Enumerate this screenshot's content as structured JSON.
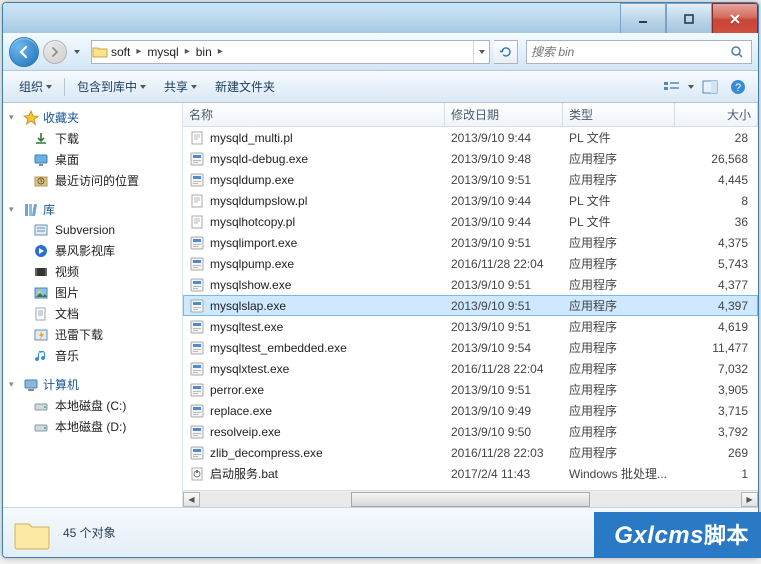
{
  "breadcrumbs": [
    "soft",
    "mysql",
    "bin"
  ],
  "search_placeholder": "搜索 bin",
  "toolbar": {
    "organize": "组织",
    "include": "包含到库中",
    "share": "共享",
    "newfolder": "新建文件夹"
  },
  "sidebar": {
    "favorites": {
      "label": "收藏夹",
      "items": [
        {
          "icon": "download",
          "label": "下载"
        },
        {
          "icon": "desktop",
          "label": "桌面"
        },
        {
          "icon": "recent",
          "label": "最近访问的位置"
        }
      ]
    },
    "libraries": {
      "label": "库",
      "items": [
        {
          "icon": "svn",
          "label": "Subversion"
        },
        {
          "icon": "storm",
          "label": "暴风影视库"
        },
        {
          "icon": "video",
          "label": "视频"
        },
        {
          "icon": "pictures",
          "label": "图片"
        },
        {
          "icon": "documents",
          "label": "文档"
        },
        {
          "icon": "thunder",
          "label": "迅雷下载"
        },
        {
          "icon": "music",
          "label": "音乐"
        }
      ]
    },
    "computer": {
      "label": "计算机",
      "items": [
        {
          "icon": "drive",
          "label": "本地磁盘 (C:)"
        },
        {
          "icon": "drive",
          "label": "本地磁盘 (D:)"
        }
      ]
    }
  },
  "columns": {
    "name": "名称",
    "date": "修改日期",
    "type": "类型",
    "size": "大小"
  },
  "files": [
    {
      "name": "mysqld_multi.pl",
      "date": "2013/9/10 9:44",
      "type": "PL 文件",
      "size": "28",
      "ico": "pl",
      "sel": false
    },
    {
      "name": "mysqld-debug.exe",
      "date": "2013/9/10 9:48",
      "type": "应用程序",
      "size": "26,568",
      "ico": "exe",
      "sel": false
    },
    {
      "name": "mysqldump.exe",
      "date": "2013/9/10 9:51",
      "type": "应用程序",
      "size": "4,445",
      "ico": "exe",
      "sel": false
    },
    {
      "name": "mysqldumpslow.pl",
      "date": "2013/9/10 9:44",
      "type": "PL 文件",
      "size": "8",
      "ico": "pl",
      "sel": false
    },
    {
      "name": "mysqlhotcopy.pl",
      "date": "2013/9/10 9:44",
      "type": "PL 文件",
      "size": "36",
      "ico": "pl",
      "sel": false
    },
    {
      "name": "mysqlimport.exe",
      "date": "2013/9/10 9:51",
      "type": "应用程序",
      "size": "4,375",
      "ico": "exe",
      "sel": false
    },
    {
      "name": "mysqlpump.exe",
      "date": "2016/11/28 22:04",
      "type": "应用程序",
      "size": "5,743",
      "ico": "exe",
      "sel": false
    },
    {
      "name": "mysqlshow.exe",
      "date": "2013/9/10 9:51",
      "type": "应用程序",
      "size": "4,377",
      "ico": "exe",
      "sel": false
    },
    {
      "name": "mysqlslap.exe",
      "date": "2013/9/10 9:51",
      "type": "应用程序",
      "size": "4,397",
      "ico": "exe",
      "sel": true
    },
    {
      "name": "mysqltest.exe",
      "date": "2013/9/10 9:51",
      "type": "应用程序",
      "size": "4,619",
      "ico": "exe",
      "sel": false
    },
    {
      "name": "mysqltest_embedded.exe",
      "date": "2013/9/10 9:54",
      "type": "应用程序",
      "size": "11,477",
      "ico": "exe",
      "sel": false
    },
    {
      "name": "mysqlxtest.exe",
      "date": "2016/11/28 22:04",
      "type": "应用程序",
      "size": "7,032",
      "ico": "exe",
      "sel": false
    },
    {
      "name": "perror.exe",
      "date": "2013/9/10 9:51",
      "type": "应用程序",
      "size": "3,905",
      "ico": "exe",
      "sel": false
    },
    {
      "name": "replace.exe",
      "date": "2013/9/10 9:49",
      "type": "应用程序",
      "size": "3,715",
      "ico": "exe",
      "sel": false
    },
    {
      "name": "resolveip.exe",
      "date": "2013/9/10 9:50",
      "type": "应用程序",
      "size": "3,792",
      "ico": "exe",
      "sel": false
    },
    {
      "name": "zlib_decompress.exe",
      "date": "2016/11/28 22:03",
      "type": "应用程序",
      "size": "269",
      "ico": "exe",
      "sel": false
    },
    {
      "name": "启动服务.bat",
      "date": "2017/2/4 11:43",
      "type": "Windows 批处理...",
      "size": "1",
      "ico": "bat",
      "sel": false
    }
  ],
  "details": {
    "count": "45 个对象"
  },
  "watermark": {
    "en": "Gxlcms",
    "cn": "脚本"
  }
}
